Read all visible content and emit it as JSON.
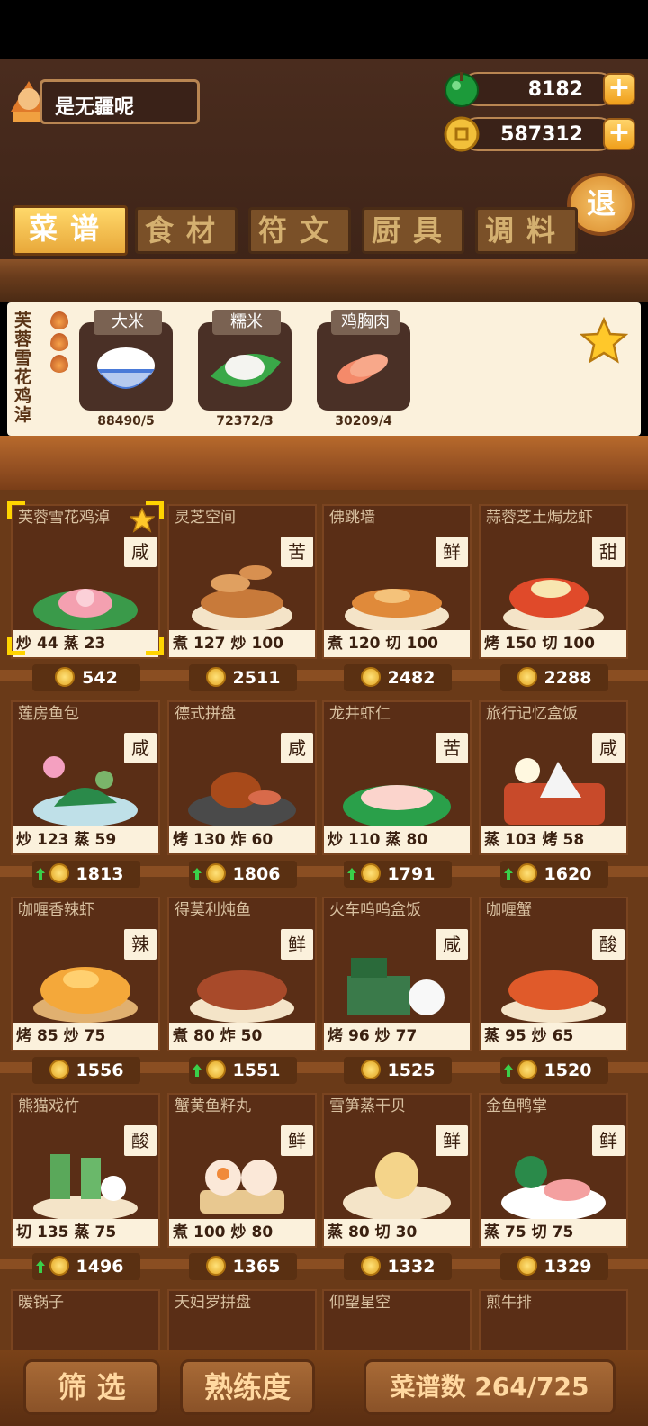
{
  "player": {
    "name": "是无疆呢"
  },
  "resources": {
    "gems": {
      "value": "8182",
      "icon": "green-gem-icon"
    },
    "coins": {
      "value": "587312",
      "icon": "gold-coin-icon"
    }
  },
  "exit_label": "退",
  "tabs": [
    {
      "label": "菜谱",
      "active": true
    },
    {
      "label": "食材",
      "active": false
    },
    {
      "label": "符文",
      "active": false
    },
    {
      "label": "厨具",
      "active": false
    },
    {
      "label": "调料",
      "active": false
    }
  ],
  "selected_recipe": {
    "title": "芙蓉雪花鸡淖",
    "ingredients": [
      {
        "name": "大米",
        "count": "88490/5"
      },
      {
        "name": "糯米",
        "count": "72372/3"
      },
      {
        "name": "鸡胸肉",
        "count": "30209/4"
      }
    ]
  },
  "recipes": [
    {
      "name": "芙蓉雪花鸡淖",
      "flavor": "咸",
      "stats": [
        "炒",
        "44",
        "蒸",
        "23"
      ],
      "price": "542",
      "up": false,
      "selected": true,
      "starred": true,
      "dish": "lotus"
    },
    {
      "name": "灵芝空间",
      "flavor": "苦",
      "stats": [
        "煮",
        "127",
        "炒",
        "100"
      ],
      "price": "2511",
      "up": false,
      "dish": "mushroom"
    },
    {
      "name": "佛跳墙",
      "flavor": "鲜",
      "stats": [
        "煮",
        "120",
        "切",
        "100"
      ],
      "price": "2482",
      "up": false,
      "dish": "soup"
    },
    {
      "name": "蒜蓉芝土焗龙虾",
      "flavor": "甜",
      "stats": [
        "烤",
        "150",
        "切",
        "100"
      ],
      "price": "2288",
      "up": false,
      "dish": "lobster"
    },
    {
      "name": "莲房鱼包",
      "flavor": "咸",
      "stats": [
        "炒",
        "123",
        "蒸",
        "59"
      ],
      "price": "1813",
      "up": true,
      "dish": "lotuspod"
    },
    {
      "name": "德式拼盘",
      "flavor": "咸",
      "stats": [
        "烤",
        "130",
        "炸",
        "60"
      ],
      "price": "1806",
      "up": true,
      "dish": "platter"
    },
    {
      "name": "龙井虾仁",
      "flavor": "苦",
      "stats": [
        "炒",
        "110",
        "蒸",
        "80"
      ],
      "price": "1791",
      "up": true,
      "dish": "shrimp"
    },
    {
      "name": "旅行记忆盒饭",
      "flavor": "咸",
      "stats": [
        "蒸",
        "103",
        "烤",
        "58"
      ],
      "price": "1620",
      "up": true,
      "dish": "bento"
    },
    {
      "name": "咖喱香辣虾",
      "flavor": "辣",
      "stats": [
        "烤",
        "85",
        "炒",
        "75"
      ],
      "price": "1556",
      "up": false,
      "dish": "curry"
    },
    {
      "name": "得莫利炖鱼",
      "flavor": "鲜",
      "stats": [
        "煮",
        "80",
        "炸",
        "50"
      ],
      "price": "1551",
      "up": true,
      "dish": "fish"
    },
    {
      "name": "火车呜呜盒饭",
      "flavor": "咸",
      "stats": [
        "烤",
        "96",
        "炒",
        "77"
      ],
      "price": "1525",
      "up": false,
      "dish": "train"
    },
    {
      "name": "咖喱蟹",
      "flavor": "酸",
      "stats": [
        "蒸",
        "95",
        "炒",
        "65"
      ],
      "price": "1520",
      "up": true,
      "dish": "crab"
    },
    {
      "name": "熊猫戏竹",
      "flavor": "酸",
      "stats": [
        "切",
        "135",
        "蒸",
        "75"
      ],
      "price": "1496",
      "up": true,
      "dish": "panda"
    },
    {
      "name": "蟹黄鱼籽丸",
      "flavor": "鲜",
      "stats": [
        "煮",
        "100",
        "炒",
        "80"
      ],
      "price": "1365",
      "up": false,
      "dish": "dumpling"
    },
    {
      "name": "雪笋蒸干贝",
      "flavor": "鲜",
      "stats": [
        "蒸",
        "80",
        "切",
        "30"
      ],
      "price": "1332",
      "up": false,
      "dish": "scallop"
    },
    {
      "name": "金鱼鸭掌",
      "flavor": "鲜",
      "stats": [
        "蒸",
        "75",
        "切",
        "75"
      ],
      "price": "1329",
      "up": false,
      "dish": "goldfish"
    },
    {
      "name": "暖锅子",
      "partial": true
    },
    {
      "name": "天妇罗拼盘",
      "partial": true
    },
    {
      "name": "仰望星空",
      "partial": true
    },
    {
      "name": "煎牛排",
      "partial": true
    }
  ],
  "bottom": {
    "filter_label": "筛 选",
    "proficiency_label": "熟练度",
    "recipe_count_label": "菜谱数 264/725"
  }
}
